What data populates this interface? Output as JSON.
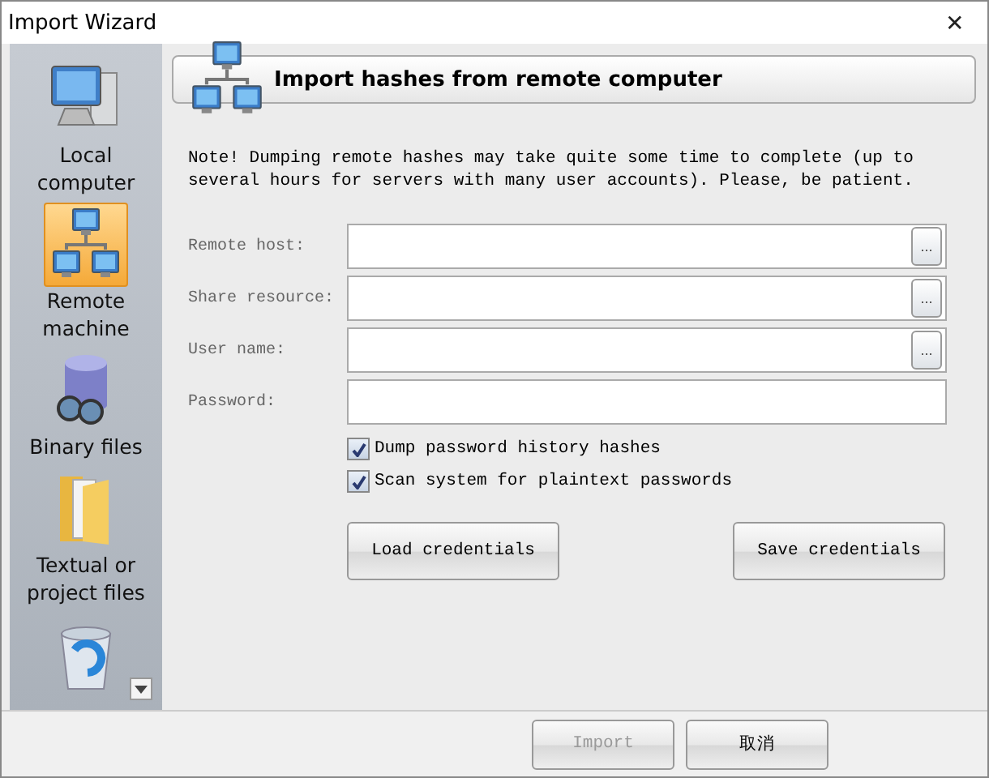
{
  "window": {
    "title": "Import Wizard",
    "close": "✕"
  },
  "sidebar": {
    "items": [
      {
        "label": "Local computer",
        "selected": false
      },
      {
        "label": "Remote machine",
        "selected": true
      },
      {
        "label": "Binary files",
        "selected": false
      },
      {
        "label": "Textual or project files",
        "selected": false
      },
      {
        "selected": false
      }
    ]
  },
  "header": {
    "title": "Import hashes from remote computer"
  },
  "note": "Note! Dumping remote hashes may take quite some time to complete (up to several hours for servers with many user accounts). Please, be patient.",
  "fields": [
    {
      "label": "Remote host:",
      "browse": "..."
    },
    {
      "label": "Share resource:",
      "browse": "..."
    },
    {
      "label": "User name:",
      "browse": "..."
    },
    {
      "label": "Password:"
    }
  ],
  "checkboxes": [
    {
      "label": "Dump password history hashes",
      "checked": true
    },
    {
      "label": "Scan system for plaintext passwords",
      "checked": true
    }
  ],
  "credential_buttons": [
    "Load credentials",
    "Save credentials"
  ],
  "footer": {
    "buttons": [
      {
        "label": "Import",
        "disabled": true
      },
      {
        "label": "取消",
        "disabled": false
      }
    ]
  }
}
